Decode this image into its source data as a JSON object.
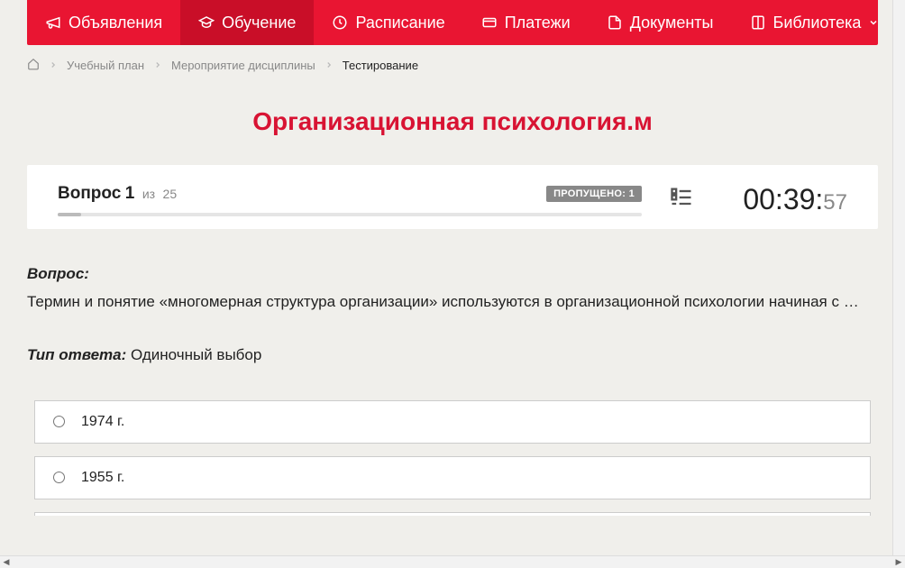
{
  "nav": {
    "items": [
      {
        "label": "Объявления",
        "icon": "megaphone",
        "active": false
      },
      {
        "label": "Обучение",
        "icon": "graduation-cap",
        "active": true
      },
      {
        "label": "Расписание",
        "icon": "clock",
        "active": false
      },
      {
        "label": "Платежи",
        "icon": "card",
        "active": false
      },
      {
        "label": "Документы",
        "icon": "file",
        "active": false
      },
      {
        "label": "Библиотека",
        "icon": "library",
        "active": false,
        "dropdown": true
      }
    ]
  },
  "breadcrumb": {
    "items": [
      {
        "label": "Учебный план"
      },
      {
        "label": "Мероприятие дисциплины"
      }
    ],
    "current": "Тестирование"
  },
  "page_title": "Организационная психология.м",
  "question_header": {
    "num_prefix": "Вопрос",
    "num": "1",
    "total_prefix": "из",
    "total": "25",
    "skipped_label": "ПРОПУЩЕНО:",
    "skipped_count": "1",
    "timer_main": "00:39:",
    "timer_sec": "57"
  },
  "question": {
    "label": "Вопрос:",
    "text": "Термин и понятие «многомерная структура организации» используются в организационной психологии начиная с …",
    "answer_type_label": "Тип ответа:",
    "answer_type": "Одиночный выбор"
  },
  "answers": [
    {
      "text": "1974 г."
    },
    {
      "text": "1955 г."
    }
  ]
}
